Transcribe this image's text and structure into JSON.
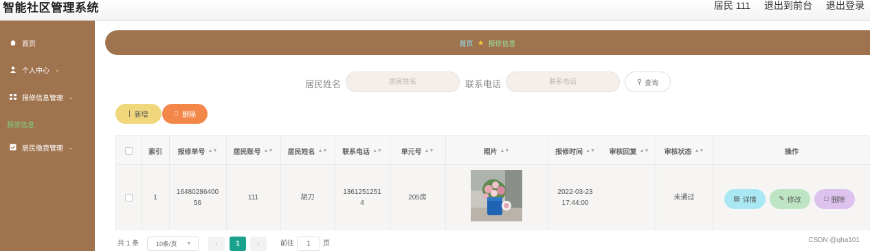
{
  "header": {
    "app_title": "智能社区管理系统",
    "user_label": "居民 111",
    "back_label": "退出到前台",
    "logout_label": "退出登录"
  },
  "sidebar": {
    "items": [
      {
        "label": "首页",
        "icon": "home-icon"
      },
      {
        "label": "个人中心",
        "icon": "user-icon"
      },
      {
        "label": "报修信息管理",
        "icon": "grid-icon"
      },
      {
        "label": "报修信息",
        "icon": ""
      },
      {
        "label": "居民缴费管理",
        "icon": "form-icon"
      }
    ]
  },
  "breadcrumb": {
    "home": "首页",
    "current": "报修信息"
  },
  "search": {
    "name_label": "居民姓名",
    "name_placeholder": "居民姓名",
    "phone_label": "联系电话",
    "phone_placeholder": "联系电话",
    "button_label": "查询"
  },
  "actions": {
    "add_label": "新增",
    "delete_label": "删除"
  },
  "table": {
    "headers": {
      "index": "索引",
      "repair_no": "报修单号",
      "account": "居民账号",
      "name": "居民姓名",
      "phone": "联系电话",
      "unit": "单元号",
      "photo": "照片",
      "time": "报修时间",
      "reply": "审核回复",
      "status": "审核状态",
      "ops": "操作"
    },
    "rows": [
      {
        "index": "1",
        "repair_no_1": "16480286400",
        "repair_no_2": "56",
        "account": "111",
        "name": "胡刀",
        "phone_1": "1361251251",
        "phone_2": "4",
        "unit": "205房",
        "photo_icon": "flower-photo",
        "time_1": "2022-03-23",
        "time_2": "17:44:00",
        "reply": "",
        "status": "未通过",
        "detail_label": "详情",
        "edit_label": "修改",
        "delete_label": "删除"
      }
    ]
  },
  "pagination": {
    "total": "共 1 条",
    "page_size": "10条/页",
    "current_page": "1",
    "goto_label": "前往",
    "goto_value": "1",
    "page_suffix": "页"
  },
  "watermark": "CSDN @qha101",
  "colors": {
    "sidebar": "#a0734f",
    "add": "#f0d77c",
    "delete": "#f3874a",
    "detail": "#a9e8f3",
    "edit": "#bde5c3",
    "row_delete": "#dcc2ec",
    "page_active": "#1aa38c"
  }
}
